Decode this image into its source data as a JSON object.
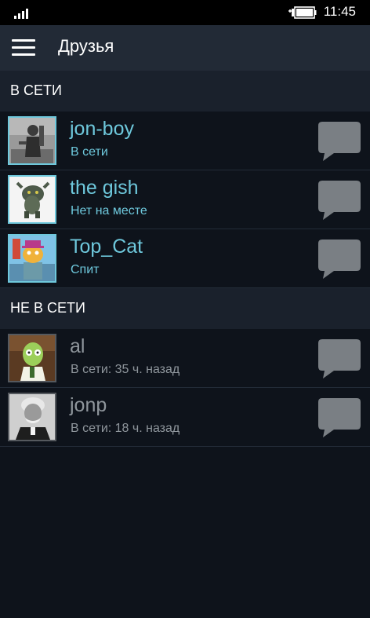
{
  "status_bar": {
    "signal_icon": "signal-bars-icon",
    "battery_icon": "battery-charging-icon",
    "time": "11:45"
  },
  "header": {
    "menu_icon": "hamburger-menu-icon",
    "title": "Друзья"
  },
  "sections": [
    {
      "label": "В СЕТИ",
      "friends": [
        {
          "name": "jon-boy",
          "status": "В сети"
        },
        {
          "name": "the gish",
          "status": "Нет на месте"
        },
        {
          "name": "Top_Cat",
          "status": "Спит"
        }
      ]
    },
    {
      "label": "НЕ В СЕТИ",
      "friends": [
        {
          "name": "al",
          "status": "В сети: 35 ч. назад"
        },
        {
          "name": "jonp",
          "status": "В сети: 18 ч. назад"
        }
      ]
    }
  ],
  "chat_icon": "chat-bubble-icon",
  "colors": {
    "background": "#0e131b",
    "header": "#222a36",
    "section": "#1a212c",
    "online": "#6ec8dc",
    "offline": "#8f969c",
    "chat_bubble": "#7a7f84"
  }
}
